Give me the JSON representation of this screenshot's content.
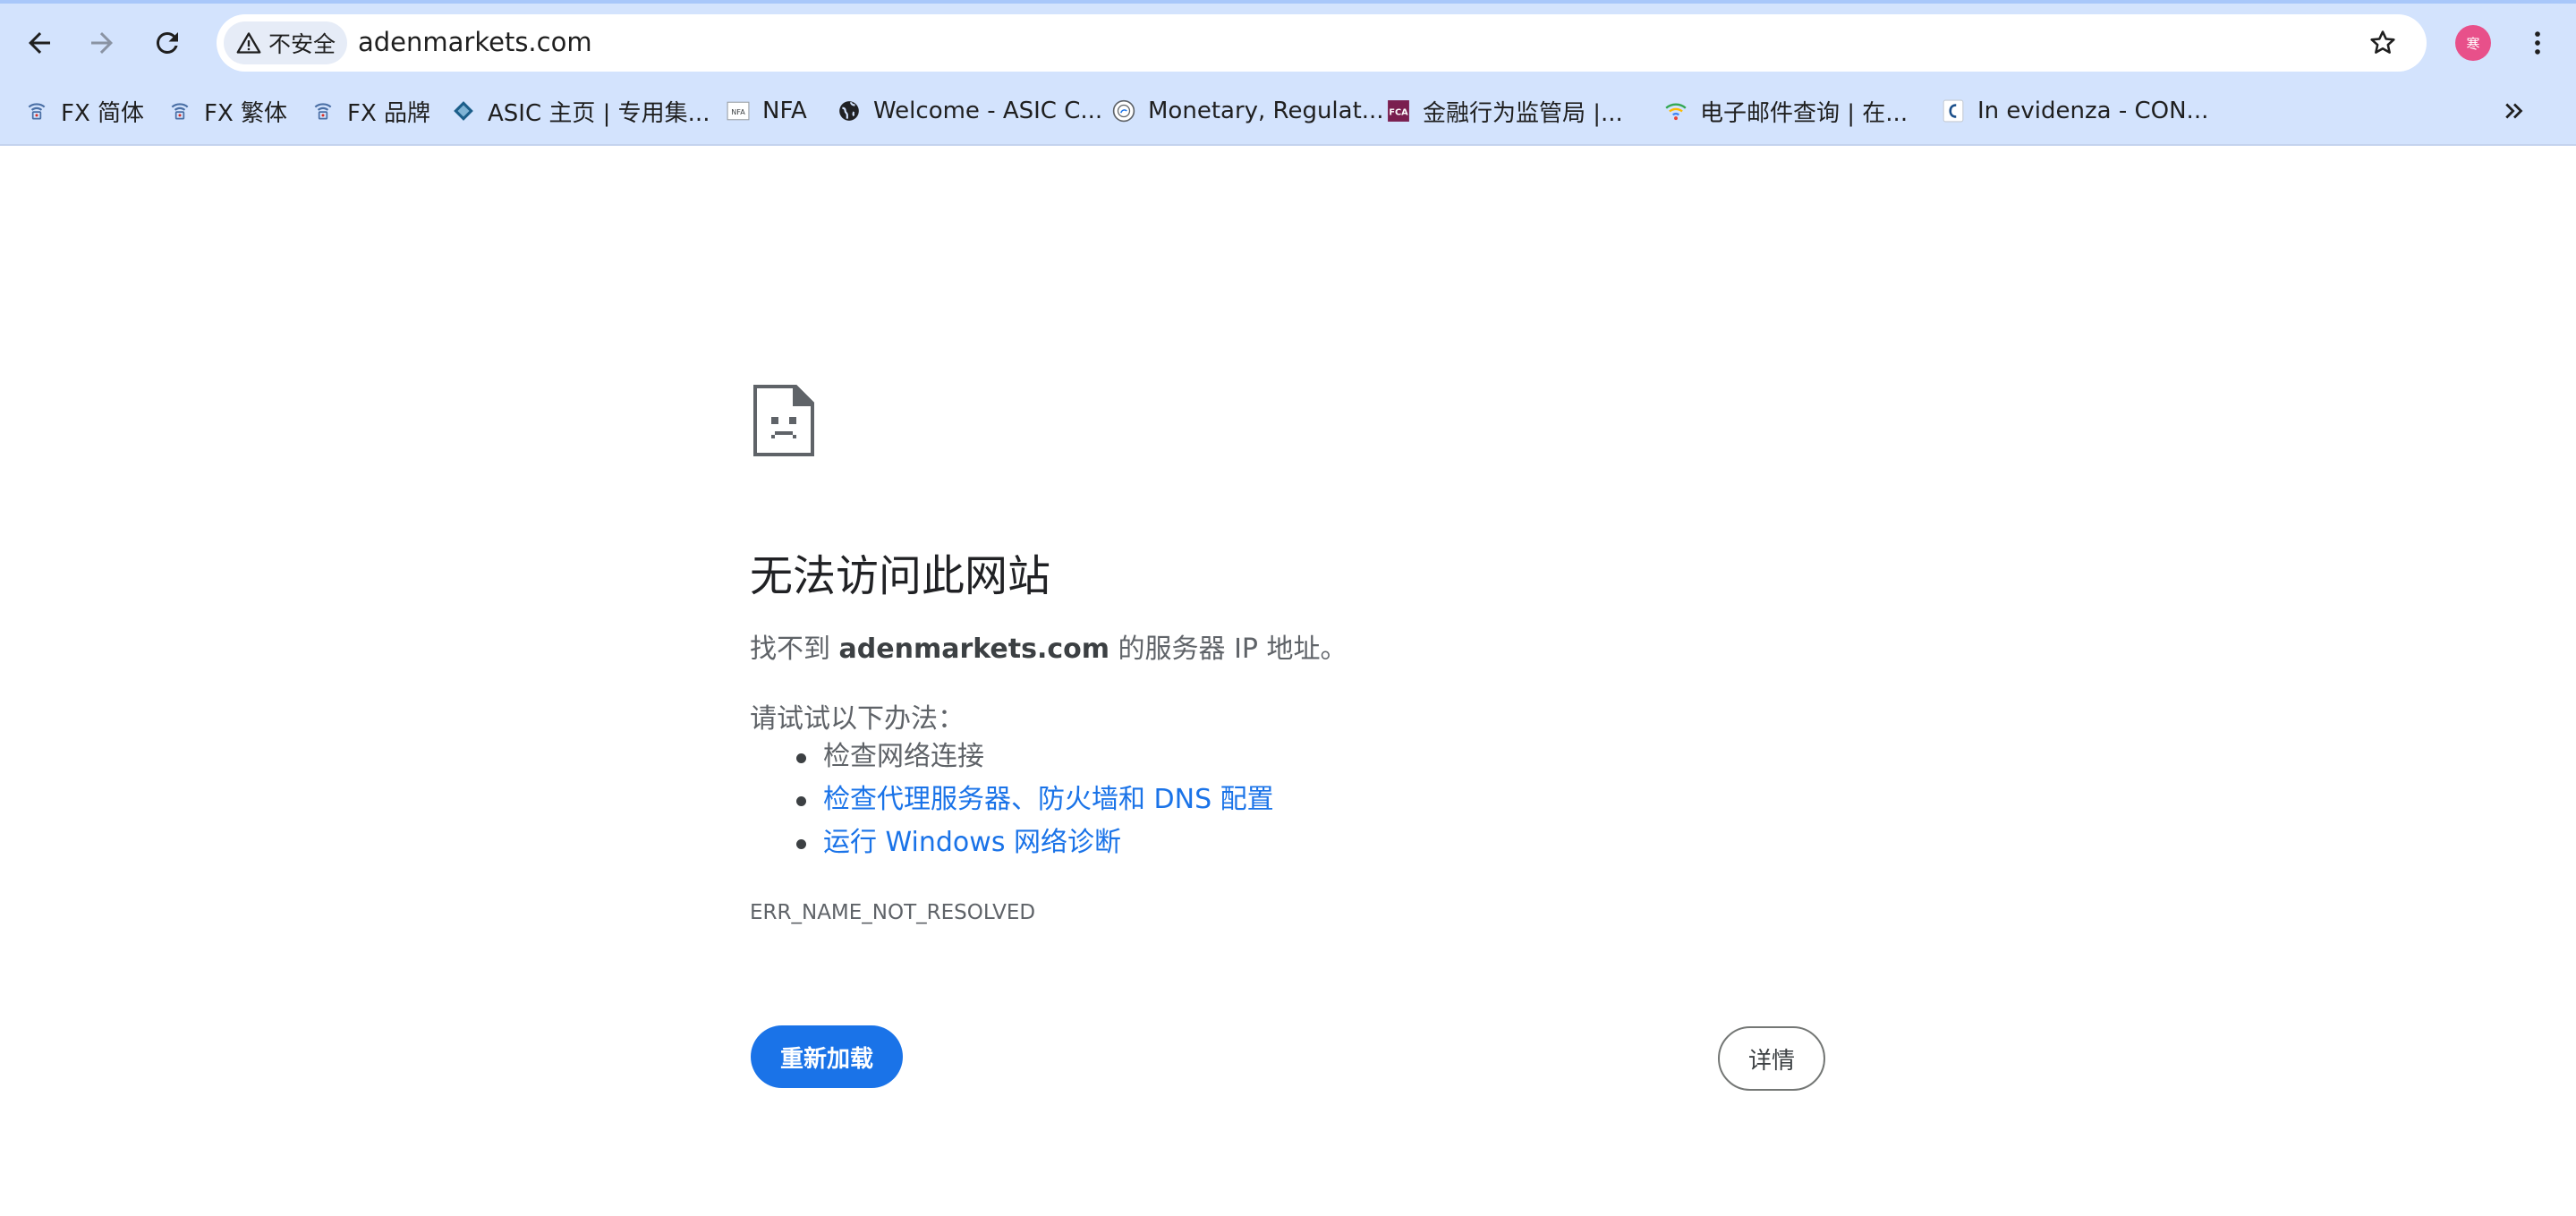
{
  "browser": {
    "security_label": "不安全",
    "url": "adenmarkets.com",
    "avatar_initial": "寒",
    "avatar_color": "#e8508a",
    "icons": {
      "back": "arrow-left-icon",
      "forward": "arrow-right-icon",
      "reload": "reload-icon",
      "security": "warning-triangle-icon",
      "bookmark": "star-icon",
      "menu": "kebab-menu-icon",
      "more_bookmarks": "double-chevron-right-icon"
    }
  },
  "bookmarks": [
    {
      "label": "FX 简体",
      "icon": "fx-logo-icon"
    },
    {
      "label": "FX 繁体",
      "icon": "fx-logo-icon"
    },
    {
      "label": "FX 品牌",
      "icon": "fx-logo-icon"
    },
    {
      "label": "ASIC 主页 | 专用集...",
      "icon": "asic-diamond-icon"
    },
    {
      "label": "NFA",
      "icon": "nfa-logo-icon"
    },
    {
      "label": "Welcome - ASIC C...",
      "icon": "globe-icon"
    },
    {
      "label": "Monetary, Regulat...",
      "icon": "seal-icon"
    },
    {
      "label": "金融行为监管局 |...",
      "icon": "fca-logo-icon"
    },
    {
      "label": "电子邮件查询 | 在...",
      "icon": "wifi-icon"
    },
    {
      "label": "In evidenza - CON...",
      "icon": "consob-logo-icon"
    }
  ],
  "error_page": {
    "icon": "sad-document-icon",
    "title": "无法访问此网站",
    "desc_prefix": "找不到 ",
    "desc_domain": "adenmarkets.com",
    "desc_suffix": " 的服务器 IP 地址。",
    "try_heading": "请试试以下办法：",
    "suggestions": [
      {
        "text": "检查网络连接",
        "is_link": false
      },
      {
        "text": "检查代理服务器、防火墙和 DNS 配置",
        "is_link": true
      },
      {
        "text": "运行 Windows 网络诊断",
        "is_link": true
      }
    ],
    "error_code": "ERR_NAME_NOT_RESOLVED",
    "reload_label": "重新加载",
    "details_label": "详情"
  },
  "colors": {
    "chrome_bg": "#d3e3fd",
    "primary": "#1a73e8",
    "link": "#1a73e8",
    "text_secondary": "#5f6368"
  }
}
